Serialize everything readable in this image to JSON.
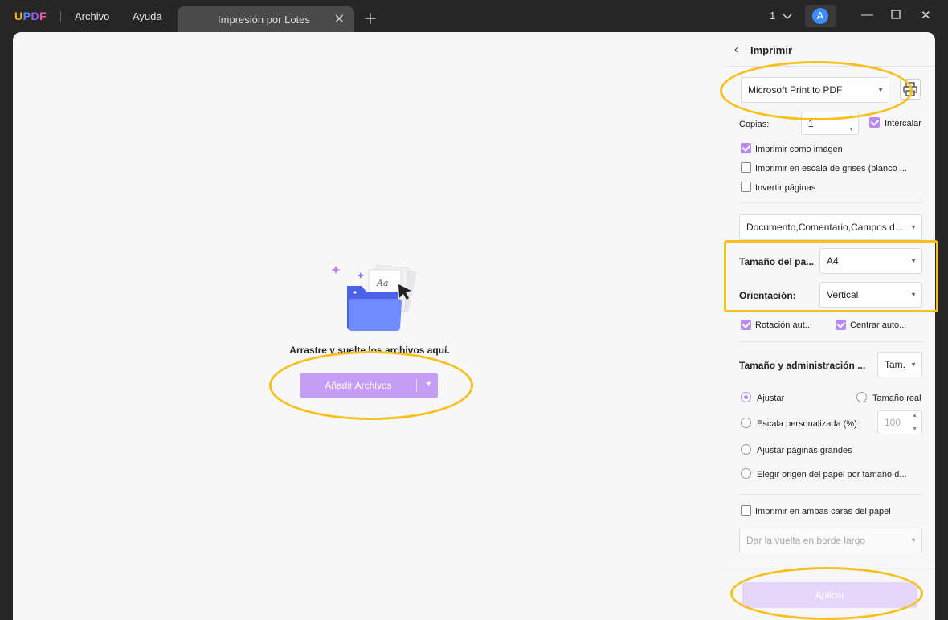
{
  "titlebar": {
    "logo": {
      "u": "U",
      "p": "P",
      "d": "D",
      "f": "F"
    },
    "menu_archivo": "Archivo",
    "menu_ayuda": "Ayuda",
    "tab_title": "Impresión por Lotes",
    "page_count": "1",
    "avatar_letter": "A"
  },
  "main": {
    "drop_text": "Arrastre y suelte los archivos aquí.",
    "add_files_label": "Añadir Archivos"
  },
  "print_panel": {
    "title": "Imprimir",
    "printer": "Microsoft Print to PDF",
    "copies_label": "Copias:",
    "copies_value": "1",
    "collate_label": "Intercalar",
    "print_as_image_label": "Imprimir como imagen",
    "grayscale_label": "Imprimir en escala de grises (blanco ...",
    "invert_pages_label": "Invertir páginas",
    "content_select": "Documento,Comentario,Campos d...",
    "paper_size_label": "Tamaño del pa...",
    "paper_size_value": "A4",
    "orientation_label": "Orientación:",
    "orientation_value": "Vertical",
    "auto_rotate_label": "Rotación aut...",
    "auto_center_label": "Centrar auto...",
    "size_mgmt_label": "Tamaño y administración ...",
    "size_mgmt_value": "Tam.",
    "fit_label": "Ajustar",
    "actual_size_label": "Tamaño real",
    "custom_scale_label": "Escala personalizada (%):",
    "custom_scale_value": "100",
    "shrink_large_label": "Ajustar páginas grandes",
    "paper_source_label": "Elegir origen del papel por tamaño d...",
    "duplex_label": "Imprimir en ambas caras del papel",
    "flip_select": "Dar la vuelta en borde largo",
    "apply_label": "Aplicar",
    "checked": {
      "collate": true,
      "print_as_image": true,
      "grayscale": false,
      "invert_pages": false,
      "auto_rotate": true,
      "auto_center": true,
      "duplex": false
    },
    "selected_scaling": "Ajustar"
  },
  "colors": {
    "accent": "#b98af2",
    "annotation": "#f8c01e",
    "titlebar": "#262626",
    "avatar": "#3f8cff"
  }
}
